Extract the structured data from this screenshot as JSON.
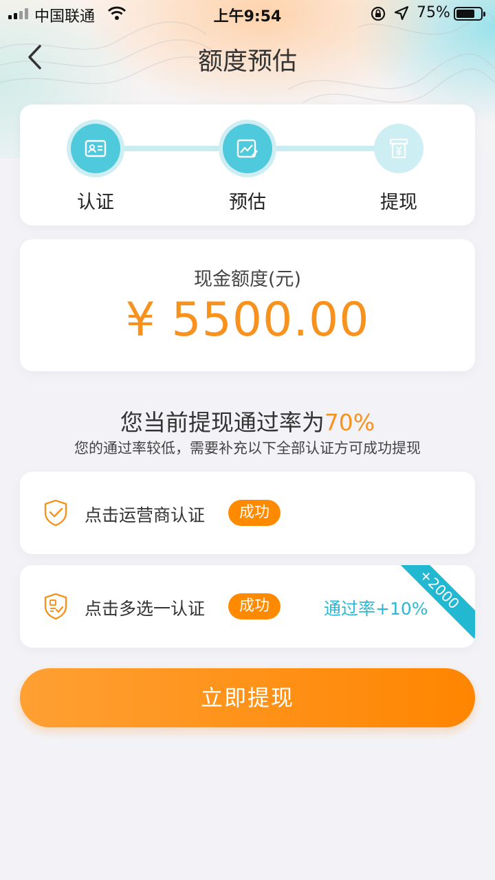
{
  "status_bar": {
    "carrier": "中国联通",
    "time": "上午9:54",
    "battery": "75%",
    "battery_level": 0.75
  },
  "nav": {
    "title": "额度预估",
    "back_icon": "chevron-left-icon"
  },
  "steps": [
    {
      "label": "认证",
      "icon": "id-card-icon",
      "state": "done"
    },
    {
      "label": "预估",
      "icon": "chart-edit-icon",
      "state": "active"
    },
    {
      "label": "提现",
      "icon": "atm-yuan-icon",
      "state": "pending"
    }
  ],
  "amount": {
    "label": "现金额度(元)",
    "value": "¥ 5500.00"
  },
  "pass_rate": {
    "prefix": "您当前提现通过率为",
    "value": "70%",
    "note": "您的通过率较低，需要补充以下全部认证方可成功提现"
  },
  "verifications": [
    {
      "label": "点击运营商认证",
      "status": "成功",
      "icon": "shield-check-icon"
    },
    {
      "label": "点击多选一认证",
      "status": "成功",
      "icon": "shield-doc-icon",
      "bonus": "通过率+10%",
      "ribbon": "+2000"
    }
  ],
  "button": {
    "label": "立即提现"
  },
  "colors": {
    "accent_orange": "#f7921e",
    "accent_cyan": "#4fc9dc",
    "badge_orange": "#ff8a00",
    "ribbon_cyan": "#22b8d2"
  }
}
